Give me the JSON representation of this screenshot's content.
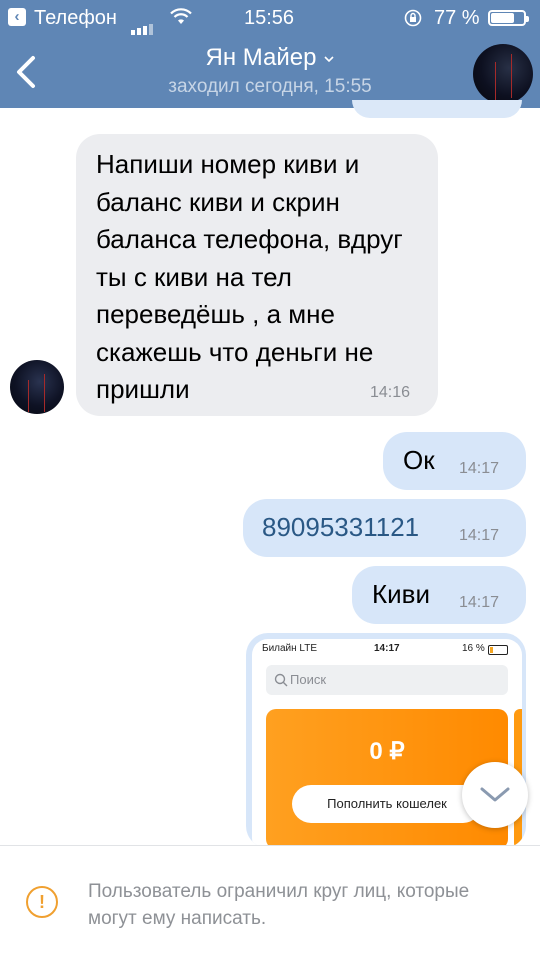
{
  "status_bar": {
    "back_app_label": "Телефон",
    "time": "15:56",
    "battery_text": "77 %",
    "battery_level": 0.77
  },
  "header": {
    "title": "Ян Майер",
    "subtitle": "заходил сегодня, 15:55",
    "back_icon": "chevron-left-icon",
    "title_icon": "chevron-down-icon"
  },
  "messages": [
    {
      "direction": "in",
      "text": "Напиши номер киви и баланс киви и скрин баланса телефона, вдруг ты с киви на тел переведёшь , а мне скажешь что деньги не пришли",
      "time": "14:16"
    },
    {
      "direction": "out",
      "text": "Ок",
      "time": "14:17"
    },
    {
      "direction": "out",
      "text": "89095331121",
      "time": "14:17"
    },
    {
      "direction": "out",
      "text": "Киви",
      "time": "14:17"
    }
  ],
  "attachment": {
    "status_carrier": "Билайн  LTE",
    "status_time": "14:17",
    "status_battery": "16 %",
    "search_placeholder": "Поиск",
    "amount": "0 ₽",
    "button": "Пополнить кошелек"
  },
  "footer": {
    "notice": "Пользователь ограничил круг лиц, которые могут ему написать.",
    "icon": "warning-icon"
  },
  "colors": {
    "header": "#5f86b5",
    "bubble_in": "#ecedf0",
    "bubble_out": "#d7e6f9",
    "qiwi_orange": "#ff8a00",
    "warning": "#f0a030"
  }
}
